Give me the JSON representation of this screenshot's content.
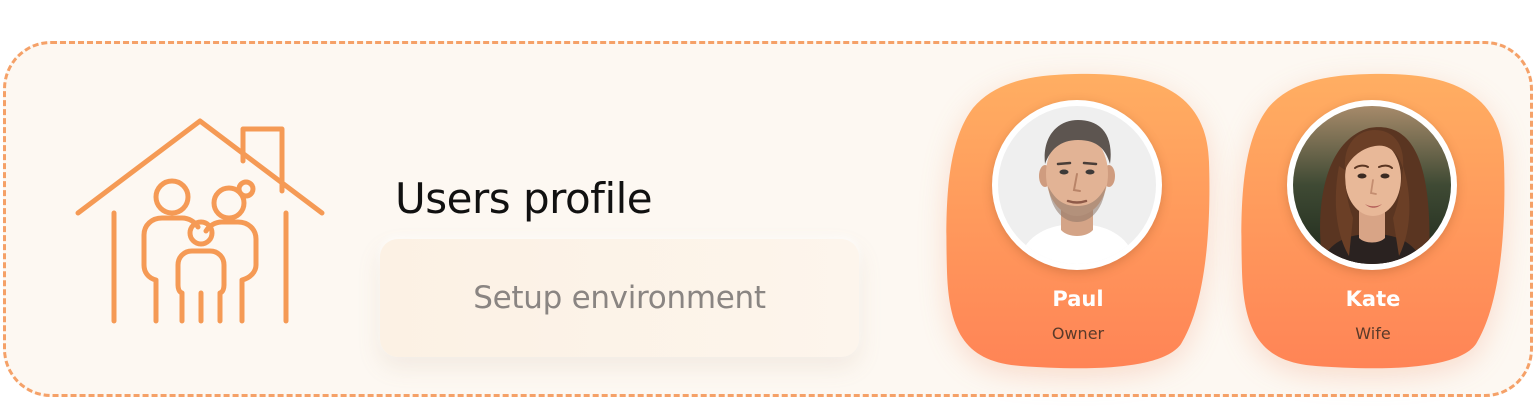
{
  "header": {
    "title": "Users profile"
  },
  "actions": {
    "setup_label": "Setup environment"
  },
  "users": [
    {
      "name": "Paul",
      "role": "Owner"
    },
    {
      "name": "Kate",
      "role": "Wife"
    }
  ],
  "icons": {
    "main": "family-house-icon"
  },
  "colors": {
    "accent": "#f5a168",
    "icon_stroke": "#f59a55",
    "panel_bg": "#fdf8f2",
    "card_gradient_top": "#ffae62",
    "card_gradient_bottom": "#ff8456"
  }
}
